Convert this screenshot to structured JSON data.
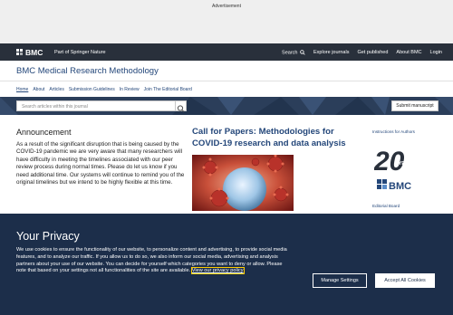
{
  "ad": {
    "label": "Advertisement"
  },
  "topnav": {
    "brand": "BMC",
    "part_of": "Part of Springer Nature",
    "links": [
      "Search",
      "Explore journals",
      "Get published",
      "About BMC",
      "Login"
    ]
  },
  "journal": {
    "title": "BMC Medical Research Methodology"
  },
  "subnav": {
    "items": [
      "Home",
      "About",
      "Articles",
      "Submission Guidelines",
      "In Review",
      "Join The Editorial Board"
    ]
  },
  "search": {
    "placeholder": "Search articles within this journal",
    "submit_label": "Submit manuscript"
  },
  "announcement": {
    "title": "Announcement",
    "body": "As a result of the significant disruption that is being caused by the COVID-19 pandemic we are very aware that many researchers will have difficulty in meeting the timelines associated with our peer review process during normal times.  Please do let us know if you need additional time. Our systems will continue to remind you of the original timelines but we intend to be highly flexible at this time."
  },
  "cfp": {
    "title": "Call for Papers: Methodologies for COVID-19 research and data analysis"
  },
  "sidebar": {
    "instructions": "Instructions for Authors",
    "logo_number": "20",
    "logo_years": "YEARS",
    "logo_brand": "BMC",
    "editorial_board": "Editorial Board"
  },
  "privacy": {
    "title": "Your Privacy",
    "text": "We use cookies to ensure the functionality of our website, to personalize content and advertising, to provide social media features, and to analyze our traffic. If you allow us to do so, we also inform our social media, advertising and analysis partners about your use of our website. You can decide for yourself which categories you want to deny or allow. Please note that based on your settings not all functionalities of the site are available. ",
    "link": "View our privacy policy",
    "manage_label": "Manage Settings",
    "accept_label": "Accept All Cookies"
  },
  "colors": {
    "nav_bg": "#29303b",
    "accent": "#24477a",
    "banner_bg": "#1c2e4a",
    "search_band": "#2b3e5a"
  },
  "icons": {
    "search": "search-icon",
    "brand": "bmc-logo-icon"
  }
}
